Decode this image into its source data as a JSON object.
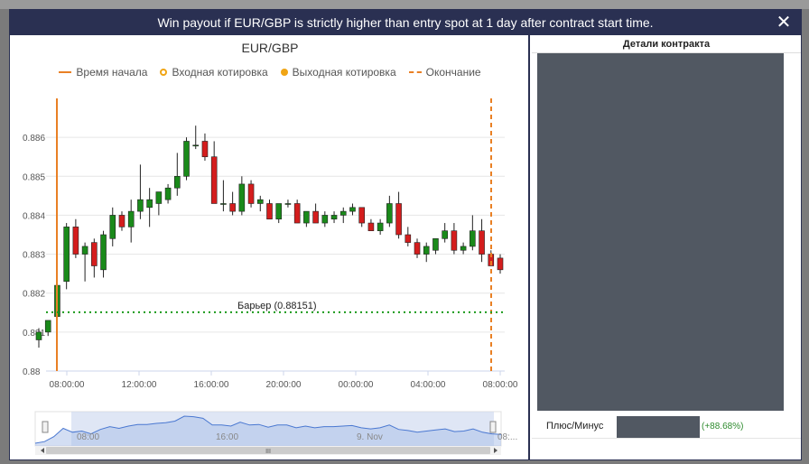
{
  "dialog": {
    "title": "Win payout if EUR/GBP is strictly higher than entry spot at 1 day after contract start time.",
    "close_glyph": "✕"
  },
  "chart": {
    "title": "EUR/GBP",
    "legend": {
      "start": "Время начала",
      "entry": "Входная котировка",
      "exit": "Выходная котировка",
      "end": "Окончание"
    },
    "barrier_label": "Барьер (0.88151)",
    "navigator_labels": [
      "08:00",
      "16:00",
      "9. Nov",
      "08:..."
    ],
    "scrollbar_grip": "III"
  },
  "chart_data": {
    "type": "candlestick",
    "title": "EUR/GBP",
    "y_ticks": [
      "0.886",
      "0.885",
      "0.884",
      "0.883",
      "0.882",
      "0.881",
      "0.88"
    ],
    "x_ticks": [
      "08:00:00",
      "12:00:00",
      "16:00:00",
      "20:00:00",
      "00:00:00",
      "04:00:00",
      "08:00:00"
    ],
    "ylim": [
      0.88,
      0.887
    ],
    "barrier": 0.88151,
    "candles": [
      {
        "o": 0.8808,
        "h": 0.8811,
        "l": 0.8806,
        "c": 0.881
      },
      {
        "o": 0.881,
        "h": 0.8813,
        "l": 0.8809,
        "c": 0.8813
      },
      {
        "o": 0.8814,
        "h": 0.8823,
        "l": 0.8812,
        "c": 0.8822
      },
      {
        "o": 0.8823,
        "h": 0.8838,
        "l": 0.8821,
        "c": 0.8837
      },
      {
        "o": 0.8837,
        "h": 0.8839,
        "l": 0.8829,
        "c": 0.883
      },
      {
        "o": 0.883,
        "h": 0.8833,
        "l": 0.8823,
        "c": 0.8832
      },
      {
        "o": 0.8833,
        "h": 0.8834,
        "l": 0.8824,
        "c": 0.8827
      },
      {
        "o": 0.8826,
        "h": 0.8836,
        "l": 0.8824,
        "c": 0.8835
      },
      {
        "o": 0.8834,
        "h": 0.8842,
        "l": 0.8832,
        "c": 0.884
      },
      {
        "o": 0.884,
        "h": 0.8841,
        "l": 0.8836,
        "c": 0.8837
      },
      {
        "o": 0.8837,
        "h": 0.8844,
        "l": 0.8833,
        "c": 0.8841
      },
      {
        "o": 0.8841,
        "h": 0.8853,
        "l": 0.8839,
        "c": 0.8844
      },
      {
        "o": 0.8842,
        "h": 0.8847,
        "l": 0.8837,
        "c": 0.8844
      },
      {
        "o": 0.8843,
        "h": 0.8846,
        "l": 0.884,
        "c": 0.8846
      },
      {
        "o": 0.8844,
        "h": 0.8848,
        "l": 0.8843,
        "c": 0.8847
      },
      {
        "o": 0.8847,
        "h": 0.8856,
        "l": 0.8845,
        "c": 0.885
      },
      {
        "o": 0.885,
        "h": 0.886,
        "l": 0.8849,
        "c": 0.8859
      },
      {
        "o": 0.8858,
        "h": 0.8863,
        "l": 0.8857,
        "c": 0.8858
      },
      {
        "o": 0.8859,
        "h": 0.8861,
        "l": 0.8854,
        "c": 0.8855
      },
      {
        "o": 0.8855,
        "h": 0.8859,
        "l": 0.8843,
        "c": 0.8843
      },
      {
        "o": 0.8843,
        "h": 0.8849,
        "l": 0.8841,
        "c": 0.8843
      },
      {
        "o": 0.8843,
        "h": 0.8846,
        "l": 0.884,
        "c": 0.8841
      },
      {
        "o": 0.8841,
        "h": 0.885,
        "l": 0.884,
        "c": 0.8848
      },
      {
        "o": 0.8848,
        "h": 0.8849,
        "l": 0.8842,
        "c": 0.8843
      },
      {
        "o": 0.8843,
        "h": 0.8845,
        "l": 0.8841,
        "c": 0.8844
      },
      {
        "o": 0.8843,
        "h": 0.8844,
        "l": 0.8839,
        "c": 0.8839
      },
      {
        "o": 0.8839,
        "h": 0.8843,
        "l": 0.8838,
        "c": 0.8843
      },
      {
        "o": 0.8843,
        "h": 0.8844,
        "l": 0.8842,
        "c": 0.8843
      },
      {
        "o": 0.8843,
        "h": 0.8844,
        "l": 0.8838,
        "c": 0.8838
      },
      {
        "o": 0.8838,
        "h": 0.8841,
        "l": 0.8837,
        "c": 0.8841
      },
      {
        "o": 0.8841,
        "h": 0.8843,
        "l": 0.8838,
        "c": 0.8838
      },
      {
        "o": 0.8838,
        "h": 0.8841,
        "l": 0.8837,
        "c": 0.884
      },
      {
        "o": 0.8839,
        "h": 0.8841,
        "l": 0.8838,
        "c": 0.884
      },
      {
        "o": 0.884,
        "h": 0.8842,
        "l": 0.8838,
        "c": 0.8841
      },
      {
        "o": 0.8841,
        "h": 0.8843,
        "l": 0.884,
        "c": 0.8842
      },
      {
        "o": 0.8842,
        "h": 0.8842,
        "l": 0.8837,
        "c": 0.8838
      },
      {
        "o": 0.8838,
        "h": 0.8839,
        "l": 0.8836,
        "c": 0.8836
      },
      {
        "o": 0.8836,
        "h": 0.8839,
        "l": 0.8835,
        "c": 0.8838
      },
      {
        "o": 0.8838,
        "h": 0.8845,
        "l": 0.8837,
        "c": 0.8843
      },
      {
        "o": 0.8843,
        "h": 0.8846,
        "l": 0.8834,
        "c": 0.8835
      },
      {
        "o": 0.8835,
        "h": 0.8837,
        "l": 0.8832,
        "c": 0.8833
      },
      {
        "o": 0.8833,
        "h": 0.8834,
        "l": 0.8829,
        "c": 0.883
      },
      {
        "o": 0.883,
        "h": 0.8833,
        "l": 0.8828,
        "c": 0.8832
      },
      {
        "o": 0.8831,
        "h": 0.8834,
        "l": 0.883,
        "c": 0.8834
      },
      {
        "o": 0.8834,
        "h": 0.8838,
        "l": 0.8833,
        "c": 0.8836
      },
      {
        "o": 0.8836,
        "h": 0.8838,
        "l": 0.883,
        "c": 0.8831
      },
      {
        "o": 0.8831,
        "h": 0.8833,
        "l": 0.883,
        "c": 0.8832
      },
      {
        "o": 0.8832,
        "h": 0.884,
        "l": 0.8831,
        "c": 0.8836
      },
      {
        "o": 0.8836,
        "h": 0.8839,
        "l": 0.8828,
        "c": 0.883
      },
      {
        "o": 0.883,
        "h": 0.8831,
        "l": 0.8827,
        "c": 0.8827
      },
      {
        "o": 0.8829,
        "h": 0.883,
        "l": 0.8825,
        "c": 0.8826
      }
    ]
  },
  "details": {
    "header": "Детали контракта",
    "profit_label": "Плюс/Минус",
    "profit_value": "(+88.68%)"
  },
  "colors": {
    "up": "#1a8a1a",
    "down": "#d41d1d",
    "marker": "#e98024",
    "barrier": "#1a9a1a",
    "title_bar": "#2a3052"
  }
}
